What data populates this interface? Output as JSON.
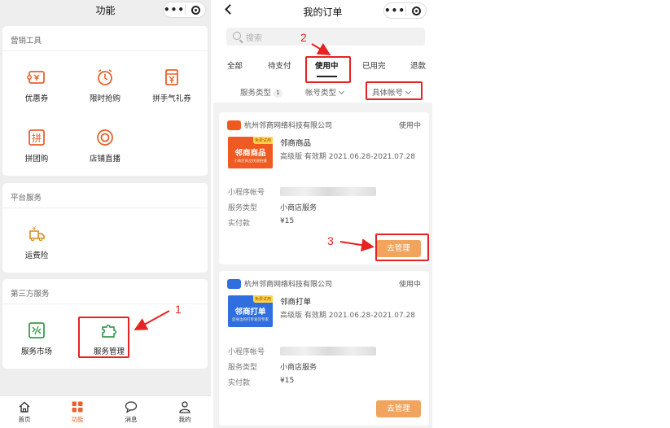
{
  "left_phone": {
    "title": "功能",
    "capsule": {
      "more": "•••",
      "close_icon": "target-icon"
    },
    "sections": [
      {
        "title": "营销工具",
        "items": [
          {
            "label": "优惠券",
            "icon": "coupon-icon"
          },
          {
            "label": "限时抢购",
            "icon": "alarm-clock-icon"
          },
          {
            "label": "拼手气礼券",
            "icon": "red-packet-icon"
          },
          {
            "label": "拼团购",
            "icon": "group-buy-icon"
          },
          {
            "label": "店铺直播",
            "icon": "live-icon"
          }
        ]
      },
      {
        "title": "平台服务",
        "items": [
          {
            "label": "运费险",
            "icon": "freight-insurance-icon"
          }
        ]
      },
      {
        "title": "第三方服务",
        "items": [
          {
            "label": "服务市场",
            "icon": "service-market-icon"
          },
          {
            "label": "服务管理",
            "icon": "puzzle-icon"
          }
        ]
      }
    ],
    "tabbar": [
      {
        "label": "首页",
        "icon": "home-icon",
        "active": false
      },
      {
        "label": "功能",
        "icon": "grid-icon",
        "active": true
      },
      {
        "label": "消息",
        "icon": "message-icon",
        "active": false
      },
      {
        "label": "我的",
        "icon": "user-icon",
        "active": false
      }
    ]
  },
  "right_phone": {
    "title": "我的订单",
    "search_placeholder": "搜索",
    "tabs": [
      "全部",
      "待支付",
      "使用中",
      "已用完",
      "退款"
    ],
    "active_tab": "使用中",
    "filters": {
      "service_type": "服务类型",
      "service_type_badge": "1",
      "account_type": "帐号类型",
      "account": "具体帐号"
    },
    "orders": [
      {
        "company": "杭州邻商网络科技有限公司",
        "status": "使用中",
        "product_name": "邻商商品",
        "product_tag": "免费试用",
        "product_logo_text": "邻商商品",
        "product_logo_sub": "小商店商品快速拍摄",
        "version": "高级版 有效期 2021.06.28-2021.07.28",
        "miniapp_label": "小程序帐号",
        "service_type_label": "服务类型",
        "service_type_value": "小商店服务",
        "paid_label": "实付款",
        "paid_value": "¥15",
        "button": "去管理",
        "brand_color": "#ee5a22"
      },
      {
        "company": "杭州邻商网络科技有限公司",
        "status": "使用中",
        "product_name": "邻商打单",
        "product_tag": "免费试用",
        "product_logo_text": "邻商打单",
        "product_logo_sub": "您身边的打单发货专家",
        "version": "高级版 有效期 2021.06.28-2021.07.28",
        "miniapp_label": "小程序帐号",
        "service_type_label": "服务类型",
        "service_type_value": "小商店服务",
        "paid_label": "实付款",
        "paid_value": "¥15",
        "button": "去管理",
        "brand_color": "#2f6fe0"
      }
    ]
  },
  "annotations": {
    "step1": "1",
    "step2": "2",
    "step3": "3",
    "color": "#e62222"
  }
}
